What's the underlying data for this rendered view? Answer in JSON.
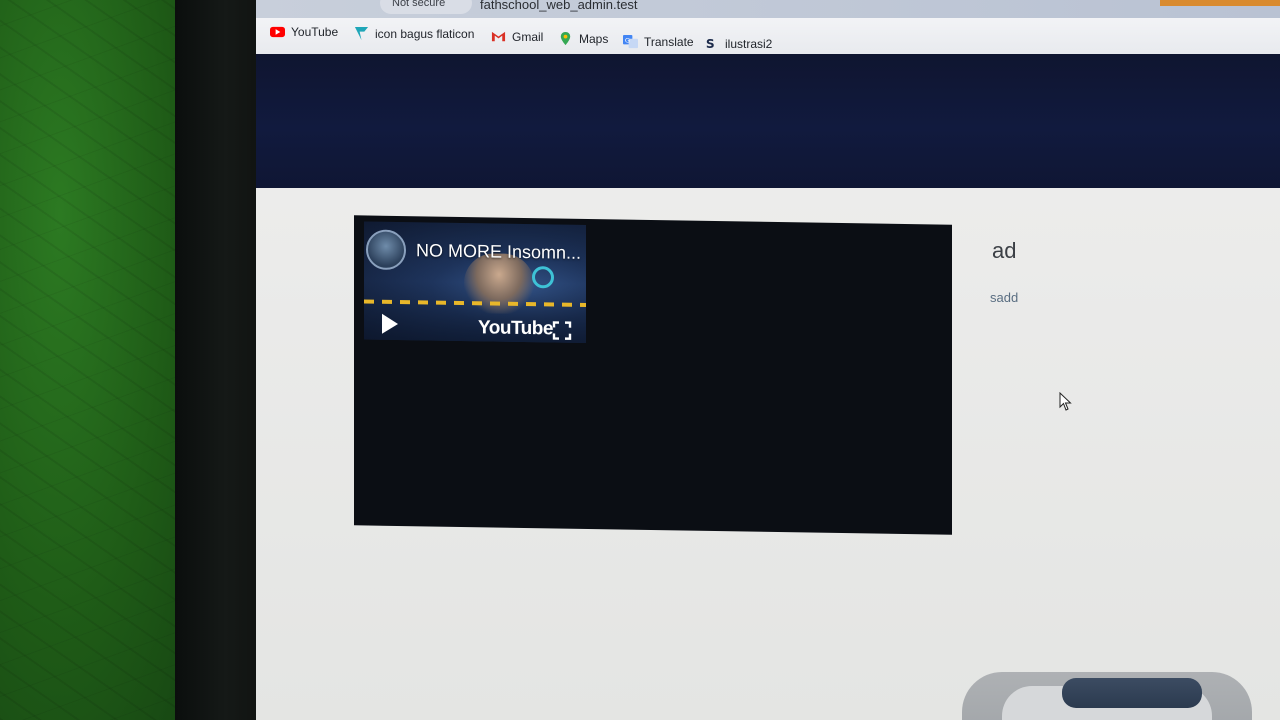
{
  "browser": {
    "security_label": "Not secure",
    "url": "fathschool_web_admin.test"
  },
  "bookmarks": [
    {
      "label": "YouTube",
      "icon": "youtube-icon"
    },
    {
      "label": "icon bagus flaticon",
      "icon": "flaticon-icon"
    },
    {
      "label": "Gmail",
      "icon": "gmail-icon"
    },
    {
      "label": "Maps",
      "icon": "maps-icon"
    },
    {
      "label": "Translate",
      "icon": "translate-icon"
    },
    {
      "label": "ilustrasi2",
      "icon": "storyset-icon"
    }
  ],
  "video": {
    "title": "NO MORE Insomn...",
    "brand": "YouTube"
  },
  "post": {
    "title": "ad",
    "description": "sadd"
  },
  "colors": {
    "banner": "#111a3e",
    "accent_youtube": "#ff0000"
  }
}
